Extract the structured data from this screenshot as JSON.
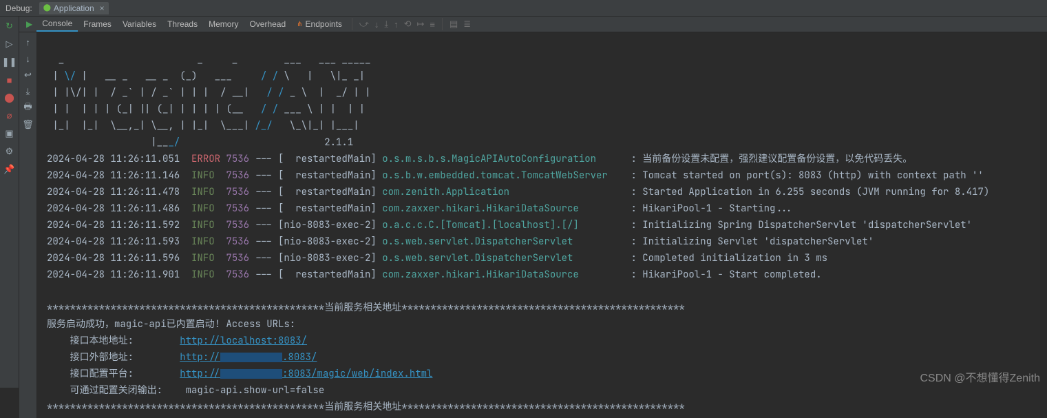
{
  "topbar": {
    "debug_label": "Debug:",
    "app_tab": "Application"
  },
  "toolbar": {
    "console": "Console",
    "frames": "Frames",
    "variables": "Variables",
    "threads": "Threads",
    "memory": "Memory",
    "overhead": "Overhead",
    "endpoints": "Endpoints"
  },
  "ascii": {
    "l0": "  _                       _     _        ___   ___ _____",
    "l1": " |  \\/           __  __   (_)   ___     / / \\   | _ \\|_ _|",
    "l2": " | |\\/| |  / _` | / _` | | | | / __|   / /   \\  |  _/ | |",
    "l3": " | |  | | | (_| || (_| | | | | \\___   / / ___ \\ | |  _| |_",
    "l4": " |_|  |_| \\__,_| \\__,  ||_|   \\__/  /_/   \\_\\|_| |___|",
    "l5": "                    |___/                        2.1.1"
  },
  "logs": [
    {
      "ts": "2024-04-28 11:26:11.051",
      "lvl": "ERROR",
      "pid": "7536",
      "thread": "[  restartedMain]",
      "logger": "o.s.m.s.b.s.MagicAPIAutoConfiguration",
      "msg": "当前备份设置未配置，强烈建议配置备份设置，以免代码丢失。"
    },
    {
      "ts": "2024-04-28 11:26:11.146",
      "lvl": "INFO",
      "pid": "7536",
      "thread": "[  restartedMain]",
      "logger": "o.s.b.w.embedded.tomcat.TomcatWebServer",
      "msg": "Tomcat started on port(s): 8083 (http) with context path ''"
    },
    {
      "ts": "2024-04-28 11:26:11.478",
      "lvl": "INFO",
      "pid": "7536",
      "thread": "[  restartedMain]",
      "logger": "com.zenith.Application",
      "msg": "Started Application in 6.255 seconds (JVM running for 8.417)"
    },
    {
      "ts": "2024-04-28 11:26:11.486",
      "lvl": "INFO",
      "pid": "7536",
      "thread": "[  restartedMain]",
      "logger": "com.zaxxer.hikari.HikariDataSource",
      "msg": "HikariPool-1 - Starting..."
    },
    {
      "ts": "2024-04-28 11:26:11.592",
      "lvl": "INFO",
      "pid": "7536",
      "thread": "[nio-8083-exec-2]",
      "logger": "o.a.c.c.C.[Tomcat].[localhost].[/]",
      "msg": "Initializing Spring DispatcherServlet 'dispatcherServlet'"
    },
    {
      "ts": "2024-04-28 11:26:11.593",
      "lvl": "INFO",
      "pid": "7536",
      "thread": "[nio-8083-exec-2]",
      "logger": "o.s.web.servlet.DispatcherServlet",
      "msg": "Initializing Servlet 'dispatcherServlet'"
    },
    {
      "ts": "2024-04-28 11:26:11.596",
      "lvl": "INFO",
      "pid": "7536",
      "thread": "[nio-8083-exec-2]",
      "logger": "o.s.web.servlet.DispatcherServlet",
      "msg": "Completed initialization in 3 ms"
    },
    {
      "ts": "2024-04-28 11:26:11.901",
      "lvl": "INFO",
      "pid": "7536",
      "thread": "[  restartedMain]",
      "logger": "com.zaxxer.hikari.HikariDataSource",
      "msg": "HikariPool-1 - Start completed."
    }
  ],
  "banner": "************************************************当前服务相关地址*************************************************",
  "urls": {
    "start_msg": "服务启动成功，magic-api已内置启动! Access URLs:",
    "local_label": "接口本地地址:",
    "local_url": "http://localhost:8083/",
    "ext_label": "接口外部地址:",
    "ext_url_pre": "http://",
    "ext_url_suf": ".8083/",
    "cfg_label": "接口配置平台:",
    "cfg_url_pre": "http://",
    "cfg_url_suf": ":8083/magic/web/index.html",
    "close_label": "可通过配置关闭输出:",
    "close_value": "magic-api.show-url=false"
  },
  "watermark": "CSDN @不想懂得Zenith"
}
